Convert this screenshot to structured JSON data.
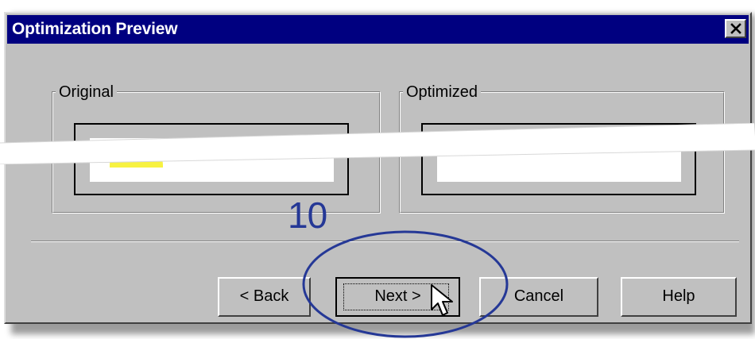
{
  "dialog": {
    "title": "Optimization Preview",
    "close_icon": "close-icon"
  },
  "groups": {
    "original_label": "Original",
    "optimized_label": "Optimized"
  },
  "buttons": {
    "back_label": "< Back",
    "next_label": "Next >",
    "cancel_label": "Cancel",
    "help_label": "Help"
  },
  "annotation": {
    "step_number": "10",
    "accent": "#253896"
  },
  "icons": {
    "cursor": "arrow-cursor-icon"
  },
  "colors": {
    "title_bar": "#000080",
    "dialog_face": "#c0c0c0",
    "preview_highlight": "#f7f241",
    "annotation": "#253896"
  }
}
